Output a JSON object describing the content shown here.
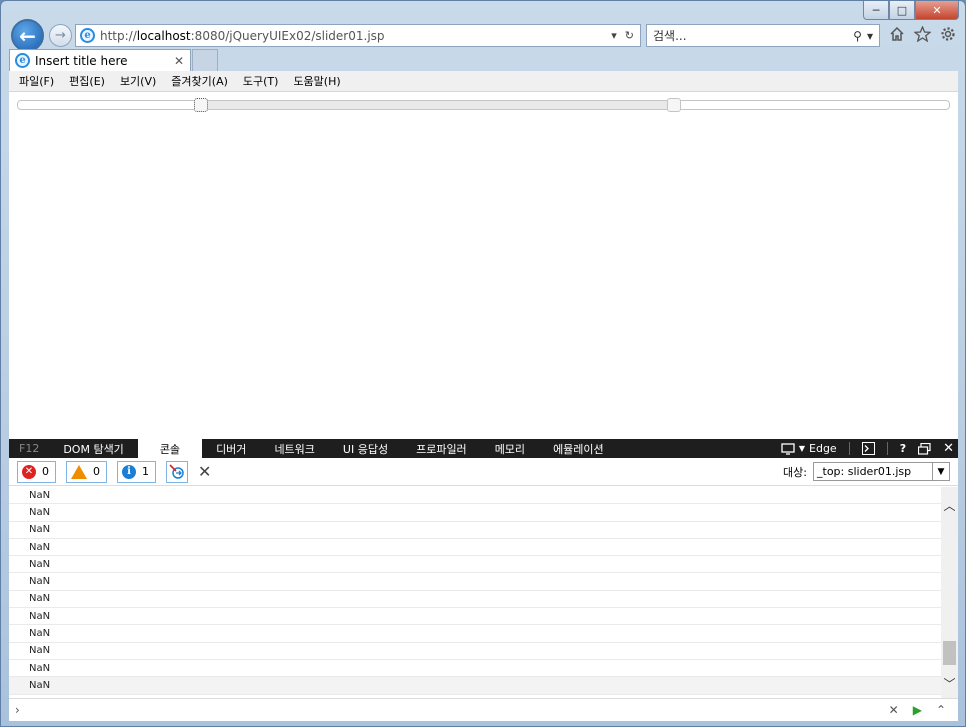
{
  "window": {
    "controls": {
      "minimize": "─",
      "maximize": "□",
      "close": "✕"
    }
  },
  "navbar": {
    "back_glyph": "←",
    "forward_glyph": "→",
    "url_prefix": "http://",
    "url_host": "localhost",
    "url_rest": ":8080/jQueryUIEx02/slider01.jsp",
    "addr_dropdown": "▾",
    "refresh": "↻",
    "search_placeholder": "검색...",
    "search_icon": "⚲",
    "search_dropdown": "▾",
    "icons": [
      "home-icon",
      "favorites-star-icon",
      "tools-gear-icon"
    ]
  },
  "tabs": [
    {
      "title": "Insert title here",
      "close": "✕"
    }
  ],
  "menubar": {
    "items": [
      "파일(F)",
      "편집(E)",
      "보기(V)",
      "즐겨찾기(A)",
      "도구(T)",
      "도움말(H)"
    ]
  },
  "slider": {
    "min": 0,
    "max": 100,
    "values": [
      19.7,
      70.5
    ]
  },
  "devtools": {
    "f12_label": "F12",
    "tabs": [
      "DOM 탐색기",
      "콘솔",
      "디버거",
      "네트워크",
      "UI 응답성",
      "프로파일러",
      "메모리",
      "에뮬레이션"
    ],
    "active_tab": 1,
    "mode_label": "Edge",
    "help": "?",
    "close": "✕",
    "errors": "0",
    "warnings": "0",
    "messages": "1",
    "target_label": "대상:",
    "target_value": "_top: slider01.jsp",
    "log": [
      "NaN",
      "NaN",
      "NaN",
      "NaN",
      "NaN",
      "NaN",
      "NaN",
      "NaN",
      "NaN",
      "NaN",
      "NaN",
      "NaN"
    ],
    "prompt": "›"
  }
}
